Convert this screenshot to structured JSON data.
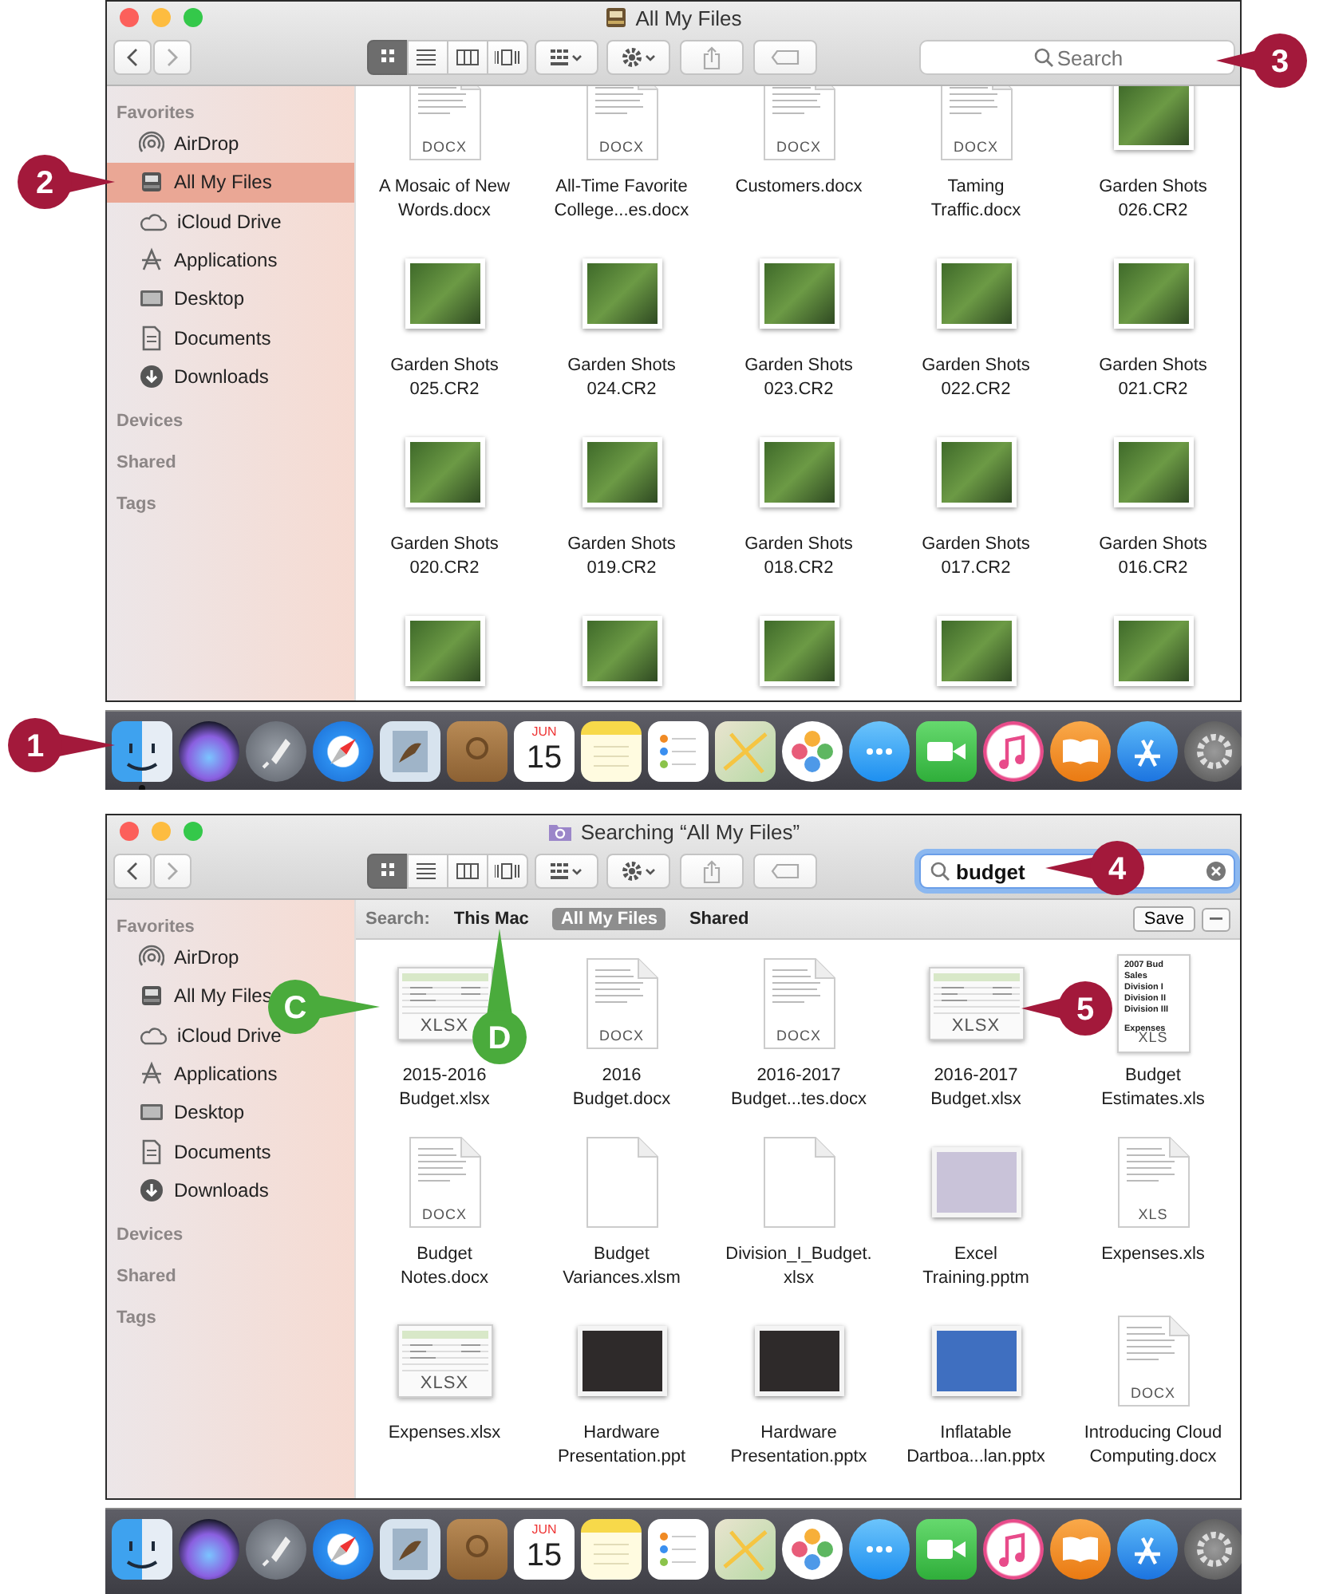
{
  "panels": [
    {
      "window": {
        "title": "All My Files"
      },
      "toolbar": {
        "views": [
          {
            "selected": true
          },
          {
            "selected": false
          },
          {
            "selected": false
          },
          {
            "selected": false
          }
        ],
        "search": {
          "placeholder": "Search",
          "focused": false
        }
      },
      "sidebar": {
        "sections": [
          {
            "title": "Favorites",
            "items": [
              {
                "label": "AirDrop",
                "kind": "airdrop",
                "selected": false
              },
              {
                "label": "All My Files",
                "kind": "files",
                "selected": true
              },
              {
                "label": "iCloud Drive",
                "kind": "cloud",
                "selected": false
              },
              {
                "label": "Applications",
                "kind": "apps",
                "selected": false
              },
              {
                "label": "Desktop",
                "kind": "desktop",
                "selected": false
              },
              {
                "label": "Documents",
                "kind": "documents",
                "selected": false
              },
              {
                "label": "Downloads",
                "kind": "downloads",
                "selected": false
              }
            ]
          },
          {
            "title": "Devices"
          },
          {
            "title": "Shared"
          },
          {
            "title": "Tags"
          }
        ]
      },
      "files": [
        {
          "name": "A Mosaic of New\nWords.docx",
          "kind": "doc",
          "badge": "DOCX"
        },
        {
          "name": "All-Time Favorite\nCollege...es.docx",
          "kind": "doc",
          "badge": "DOCX"
        },
        {
          "name": "Customers.docx",
          "kind": "doc",
          "badge": "DOCX"
        },
        {
          "name": "Taming\nTraffic.docx",
          "kind": "doc",
          "badge": "DOCX"
        },
        {
          "name": "Garden Shots\n026.CR2",
          "kind": "photo"
        },
        {
          "name": "Garden Shots\n025.CR2",
          "kind": "photo"
        },
        {
          "name": "Garden Shots\n024.CR2",
          "kind": "photo"
        },
        {
          "name": "Garden Shots\n023.CR2",
          "kind": "photo"
        },
        {
          "name": "Garden Shots\n022.CR2",
          "kind": "photo"
        },
        {
          "name": "Garden Shots\n021.CR2",
          "kind": "photo"
        },
        {
          "name": "Garden Shots\n020.CR2",
          "kind": "photo"
        },
        {
          "name": "Garden Shots\n019.CR2",
          "kind": "photo"
        },
        {
          "name": "Garden Shots\n018.CR2",
          "kind": "photo"
        },
        {
          "name": "Garden Shots\n017.CR2",
          "kind": "photo"
        },
        {
          "name": "Garden Shots\n016.CR2",
          "kind": "photo"
        },
        {
          "kind": "photo"
        },
        {
          "kind": "photo"
        },
        {
          "kind": "photo"
        },
        {
          "kind": "photo"
        },
        {
          "kind": "photo"
        }
      ],
      "dock": [
        {
          "kind": "finder",
          "running": true
        },
        {
          "kind": "siri",
          "running": false
        },
        {
          "kind": "launchpad",
          "running": false
        },
        {
          "kind": "safari",
          "running": false
        },
        {
          "kind": "mail",
          "running": false
        },
        {
          "kind": "contacts",
          "running": false
        },
        {
          "kind": "calendar",
          "month": "JUN",
          "day": "15",
          "running": false
        },
        {
          "kind": "notes",
          "running": false
        },
        {
          "kind": "reminders",
          "running": false
        },
        {
          "kind": "maps",
          "running": false
        },
        {
          "kind": "photos",
          "running": false
        },
        {
          "kind": "messages",
          "running": false
        },
        {
          "kind": "facetime",
          "running": false
        },
        {
          "kind": "itunes",
          "running": false
        },
        {
          "kind": "ibooks",
          "running": false
        },
        {
          "kind": "appstore",
          "running": false
        },
        {
          "kind": "preferences",
          "running": false
        }
      ],
      "callouts": [
        {
          "label": "3",
          "color": "#a3193b"
        },
        {
          "label": "2",
          "color": "#a3193b"
        },
        {
          "label": "1",
          "color": "#a3193b"
        }
      ]
    },
    {
      "window": {
        "title": "Searching “All My Files”"
      },
      "toolbar": {
        "views": [
          {
            "selected": true
          },
          {
            "selected": false
          },
          {
            "selected": false
          },
          {
            "selected": false
          }
        ],
        "search": {
          "value": "budget",
          "focused": true
        }
      },
      "scope_bar": {
        "label": "Search:",
        "scopes": [
          {
            "label": "This Mac",
            "selected": false
          },
          {
            "label": "All My Files",
            "selected": true
          },
          {
            "label": "Shared",
            "selected": false
          }
        ],
        "save": "Save"
      },
      "sidebar": {
        "sections": [
          {
            "title": "Favorites",
            "items": [
              {
                "label": "AirDrop",
                "kind": "airdrop",
                "selected": false
              },
              {
                "label": "All My Files",
                "kind": "files",
                "selected": false
              },
              {
                "label": "iCloud Drive",
                "kind": "cloud",
                "selected": false
              },
              {
                "label": "Applications",
                "kind": "apps",
                "selected": false
              },
              {
                "label": "Desktop",
                "kind": "desktop",
                "selected": false
              },
              {
                "label": "Documents",
                "kind": "documents",
                "selected": false
              },
              {
                "label": "Downloads",
                "kind": "downloads",
                "selected": false
              }
            ]
          },
          {
            "title": "Devices"
          },
          {
            "title": "Shared"
          },
          {
            "title": "Tags"
          }
        ]
      },
      "files": [
        {
          "name": "2015-2016\nBudget.xlsx",
          "kind": "sheet",
          "badge": "XLSX"
        },
        {
          "name": "2016\nBudget.docx",
          "kind": "doc",
          "badge": "DOCX"
        },
        {
          "name": "2016-2017\nBudget...tes.docx",
          "kind": "doc",
          "badge": "DOCX"
        },
        {
          "name": "2016-2017\nBudget.xlsx",
          "kind": "sheet",
          "badge": "XLSX"
        },
        {
          "name": "Budget\nEstimates.xls",
          "kind": "memo",
          "badge": "XLS",
          "lines": [
            "2007 Bud",
            "Sales",
            "Division I",
            "Division II",
            "Division III",
            "Expenses"
          ]
        },
        {
          "name": "Budget\nNotes.docx",
          "kind": "doc",
          "badge": "DOCX"
        },
        {
          "name": "Budget\nVariances.xlsm",
          "kind": "blank"
        },
        {
          "name": "Division_I_Budget.\nxlsx",
          "kind": "blank"
        },
        {
          "name": "Excel\nTraining.pptm",
          "kind": "slide",
          "color": "#c9c3d9"
        },
        {
          "name": "Expenses.xls",
          "kind": "doc",
          "badge": "XLS"
        },
        {
          "name": "Expenses.xlsx",
          "kind": "sheet",
          "badge": "XLSX"
        },
        {
          "name": "Hardware\nPresentation.ppt",
          "kind": "slide",
          "color": "#2e2a2a"
        },
        {
          "name": "Hardware\nPresentation.pptx",
          "kind": "slide",
          "color": "#2e2a2a"
        },
        {
          "name": "Inflatable\nDartboa...lan.pptx",
          "kind": "slide",
          "color": "#3f6fc0"
        },
        {
          "name": "Introducing Cloud\nComputing.docx",
          "kind": "doc",
          "badge": "DOCX"
        }
      ],
      "dock": [
        {
          "kind": "finder",
          "running": false
        },
        {
          "kind": "siri",
          "running": false
        },
        {
          "kind": "launchpad",
          "running": false
        },
        {
          "kind": "safari",
          "running": false
        },
        {
          "kind": "mail",
          "running": false
        },
        {
          "kind": "contacts",
          "running": false
        },
        {
          "kind": "calendar",
          "month": "JUN",
          "day": "15",
          "running": false
        },
        {
          "kind": "notes",
          "running": false
        },
        {
          "kind": "reminders",
          "running": false
        },
        {
          "kind": "maps",
          "running": false
        },
        {
          "kind": "photos",
          "running": false
        },
        {
          "kind": "messages",
          "running": false
        },
        {
          "kind": "facetime",
          "running": false
        },
        {
          "kind": "itunes",
          "running": false
        },
        {
          "kind": "ibooks",
          "running": false
        },
        {
          "kind": "appstore",
          "running": false
        },
        {
          "kind": "preferences",
          "running": false
        }
      ],
      "callouts": [
        {
          "label": "4",
          "color": "#a3193b"
        },
        {
          "label": "C",
          "color": "#4aab3c"
        },
        {
          "label": "5",
          "color": "#a3193b"
        },
        {
          "label": "D",
          "color": "#4aab3c"
        }
      ]
    }
  ]
}
